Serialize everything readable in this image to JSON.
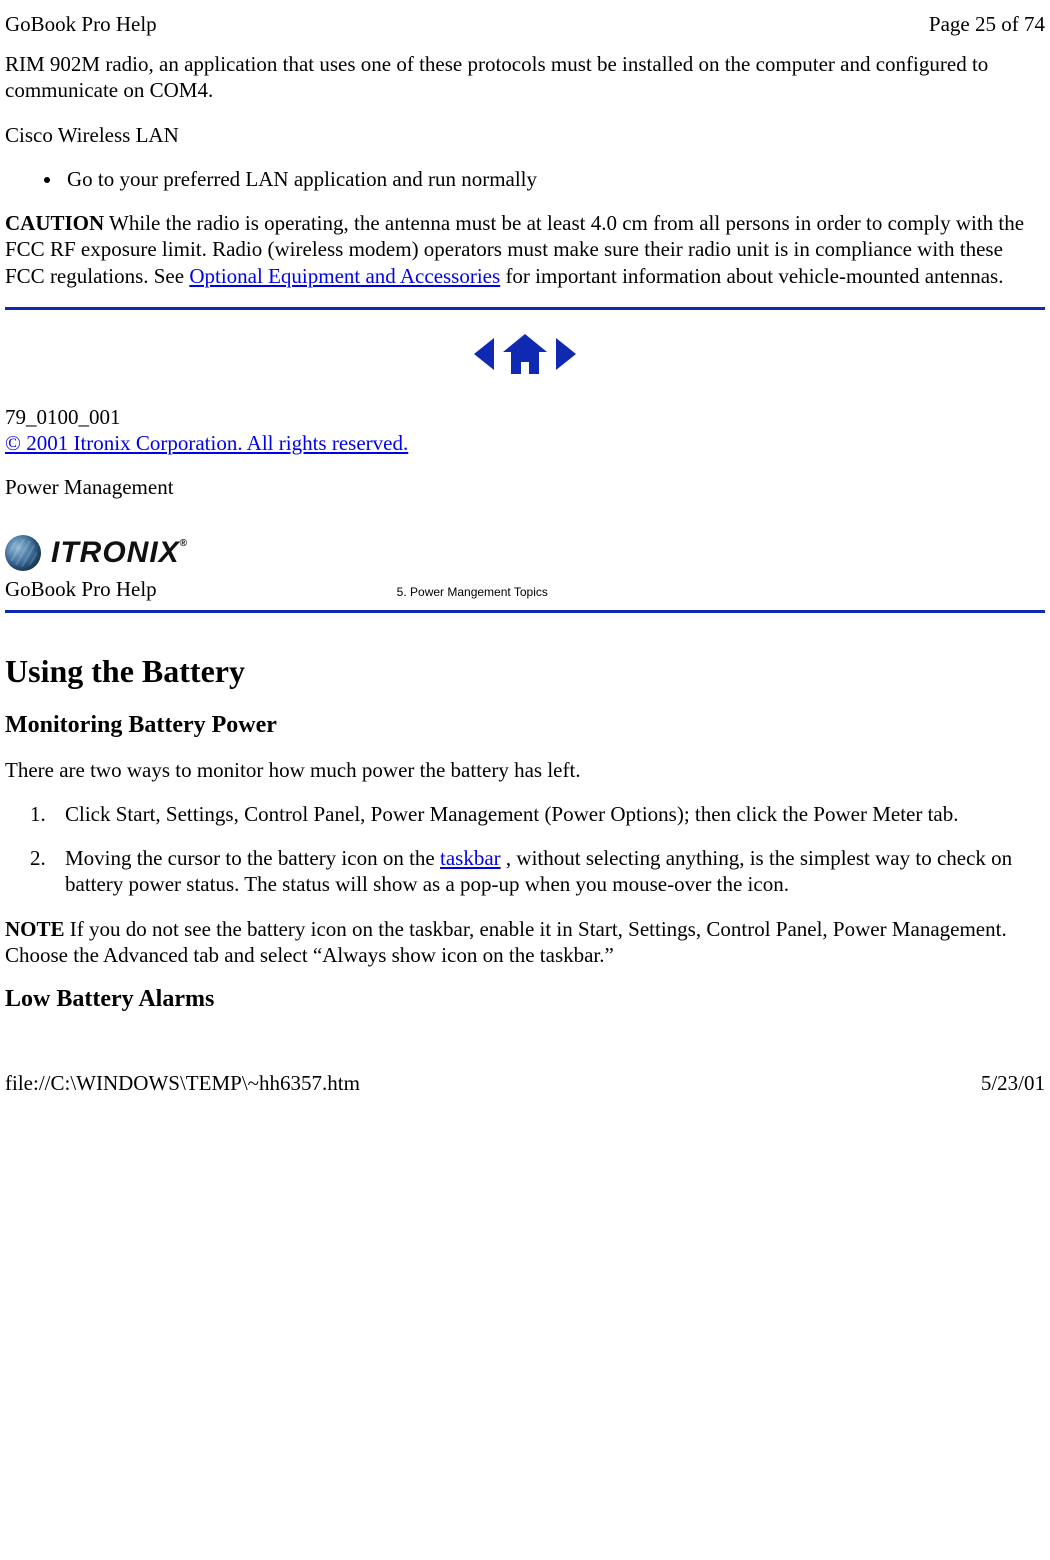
{
  "header": {
    "title": "GoBook Pro Help",
    "page_info": "Page 25 of 74"
  },
  "body": {
    "p_intro": "RIM 902M radio, an application that uses one of these protocols must be installed on the computer and configured to communicate on COM4.",
    "p_cisco": "Cisco Wireless LAN",
    "bullet_lan": "Go to your preferred LAN application and run normally",
    "caution_label": "CAUTION",
    "caution_text1": "  While the radio is operating, the antenna must be at least 4.0 cm from all persons in order to comply with the FCC RF exposure limit.  Radio (wireless modem) operators must make sure their radio unit is in compliance with these FCC regulations.  See ",
    "caution_link": "Optional Equipment and Accessories",
    "caution_text2": " for important information about vehicle-mounted antennas.",
    "doc_id": "79_0100_001",
    "copyright": "© 2001 Itronix Corporation.  All rights reserved.",
    "section_label": "Power Management",
    "brand": "ITRONIX",
    "help_label2": "GoBook Pro Help",
    "topic_label": "5. Power Mangement Topics",
    "h_battery": "Using the Battery",
    "h_monitor": "Monitoring Battery Power",
    "p_twoways": "There are two ways to monitor how much power the battery has left.",
    "ol1": "Click Start, Settings, Control Panel, Power Management (Power Options); then click the Power Meter tab.",
    "ol2a": "Moving the cursor to the battery icon on the ",
    "ol2_link": "taskbar",
    "ol2b": " , without selecting anything,  is the simplest way to check on battery power status.  The status will show as a pop-up when you mouse-over the icon.",
    "note_label": "NOTE",
    "note_text": "  If you do not see the battery icon on the taskbar, enable it in Start, Settings, Control Panel, Power Management. Choose the Advanced tab and select “Always show icon on the taskbar.”",
    "h_low": "Low Battery Alarms"
  },
  "footer": {
    "path": "file://C:\\WINDOWS\\TEMP\\~hh6357.htm",
    "date": "5/23/01"
  }
}
